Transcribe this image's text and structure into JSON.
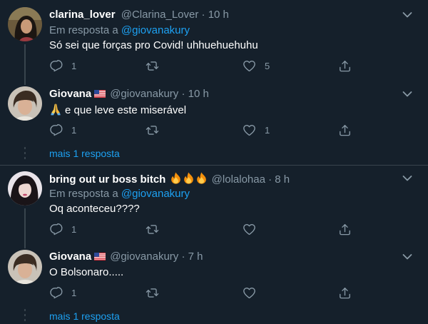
{
  "tweets": [
    {
      "name": "clarina_lover",
      "handle": "@Clarina_Lover",
      "time": "· 10 h",
      "reply_prefix": "Em resposta a",
      "reply_to": "@giovanakury",
      "text": "Só sei que forças pro Covid! uhhuehuehuhu",
      "replies": "1",
      "retweets": "",
      "likes": "5"
    },
    {
      "name": "Giovana",
      "handle": "@giovanakury",
      "time": "· 10 h",
      "text": "e que leve este miserável",
      "replies": "1",
      "retweets": "",
      "likes": "1",
      "more_replies": "mais 1 resposta"
    },
    {
      "name": "bring out ur boss bitch",
      "handle": "@lolalohaa",
      "time": "· 8 h",
      "reply_prefix": "Em resposta a",
      "reply_to": "@giovanakury",
      "text": "Oq aconteceu????",
      "replies": "1",
      "retweets": "",
      "likes": ""
    },
    {
      "name": "Giovana",
      "handle": "@giovanakury",
      "time": "· 7 h",
      "text": "O Bolsonaro.....",
      "replies": "1",
      "retweets": "",
      "likes": "",
      "more_replies": "mais 1 resposta"
    }
  ],
  "icons": {
    "reply": "reply-icon",
    "retweet": "retweet-icon",
    "like": "like-icon",
    "share": "share-icon",
    "more": "chevron-down-icon"
  },
  "colors": {
    "background": "#15202b",
    "secondary_text": "#8899a6",
    "link": "#1da1f2",
    "divider": "#38444d"
  }
}
